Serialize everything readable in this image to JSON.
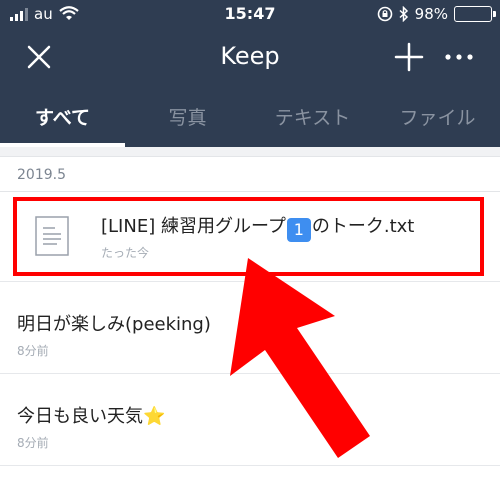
{
  "status_bar": {
    "carrier": "au",
    "time": "15:47",
    "battery_percent": "98%",
    "battery_level": 0.98
  },
  "navbar": {
    "title": "Keep",
    "icons": [
      "close-icon",
      "plus-icon",
      "more-icon"
    ]
  },
  "tabs": [
    {
      "label": "すべて",
      "active": true
    },
    {
      "label": "写真",
      "active": false
    },
    {
      "label": "テキスト",
      "active": false
    },
    {
      "label": "ファイル",
      "active": false
    }
  ],
  "content": {
    "section_label": "2019.5",
    "items": [
      {
        "type": "file",
        "name_before": "[LINE] 練習用グループ",
        "emoji": "1",
        "name_after": "のトーク.txt",
        "time": "たった今"
      },
      {
        "type": "text",
        "name": "明日が楽しみ(peeking)",
        "time": "8分前"
      },
      {
        "type": "text",
        "name": "今日も良い天気",
        "emoji": "⭐",
        "time": "8分前"
      }
    ]
  },
  "colors": {
    "header_bg": "#2f3d52",
    "highlight": "#ff0000",
    "battery": "#3ec43e"
  }
}
